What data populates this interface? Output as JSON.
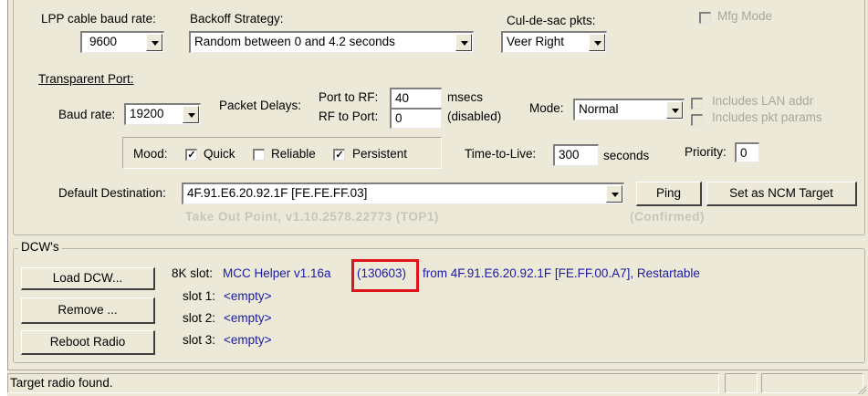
{
  "lpp": {
    "baud_label": "LPP cable baud rate:",
    "baud_value": "9600",
    "backoff_label": "Backoff Strategy:",
    "backoff_value": "Random between 0 and 4.2 seconds",
    "culdesac_label": "Cul-de-sac pkts:",
    "culdesac_value": "Veer Right",
    "mfg_mode_label": "Mfg Mode"
  },
  "transparent": {
    "title": "Transparent Port:",
    "baud_label": "Baud rate:",
    "baud_value": "19200",
    "packet_delays_label": "Packet Delays:",
    "port_to_rf_label": "Port to RF:",
    "port_to_rf_value": "40",
    "rf_to_port_label": "RF to Port:",
    "rf_to_port_value": "0",
    "msecs_label": "msecs",
    "disabled_label": "(disabled)",
    "mode_label": "Mode:",
    "mode_value": "Normal",
    "includes_lan_label": "Includes LAN addr",
    "includes_pkt_label": "Includes pkt params"
  },
  "mood": {
    "label": "Mood:",
    "quick": {
      "label": "Quick",
      "checked": true
    },
    "reliable": {
      "label": "Reliable",
      "checked": false
    },
    "persistent": {
      "label": "Persistent",
      "checked": true
    },
    "ttl_label": "Time-to-Live:",
    "ttl_value": "300",
    "seconds_label": "seconds",
    "priority_label": "Priority:",
    "priority_value": "0"
  },
  "destination": {
    "label": "Default Destination:",
    "value": "4F.91.E6.20.92.1F [FE.FE.FF.03]",
    "ping_label": "Ping",
    "ncm_label": "Set as NCM Target",
    "sub_info": "Take Out Point, v1.10.2578.22773 (TOP1)",
    "confirmed": "(Confirmed)"
  },
  "dcw": {
    "title": "DCW's",
    "load_label": "Load DCW...",
    "remove_label": "Remove ...",
    "reboot_label": "Reboot Radio",
    "slot8k_label": "8K slot:",
    "slot8k_name": "MCC Helper  v1.16a",
    "slot8k_code": "(130603)",
    "slot8k_rest": "from  4F.91.E6.20.92.1F  [FE.FF.00.A7], Restartable",
    "slot1_label": "slot 1:",
    "slot1_value": "<empty>",
    "slot2_label": "slot 2:",
    "slot2_value": "<empty>",
    "slot3_label": "slot 3:",
    "slot3_value": "<empty>"
  },
  "status": {
    "text": "Target radio found."
  },
  "colors": {
    "highlight": "#e0151b",
    "link_blue": "#1a1aa6",
    "window_bg": "#ece9d8"
  }
}
